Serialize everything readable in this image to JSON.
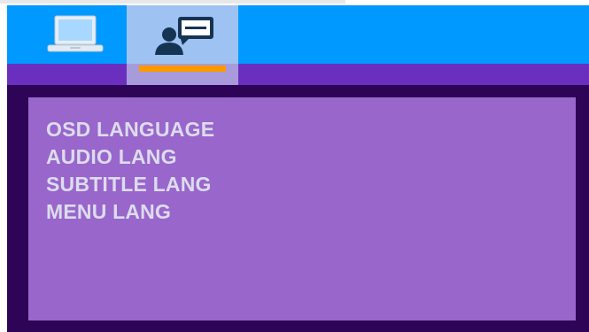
{
  "tabs": [
    {
      "icon": "monitor-icon",
      "selected": false
    },
    {
      "icon": "user-chat-icon",
      "selected": true
    }
  ],
  "colors": {
    "tab_bar": "#0099ff",
    "selected_tab": "#9ec2f2",
    "selected_underline": "#ff9900",
    "band": "#6b2fbf",
    "frame": "#2e0456",
    "panel": "#9966cc",
    "menu_text": "#dcdcec"
  },
  "menu": {
    "items": [
      {
        "label": "OSD LANGUAGE"
      },
      {
        "label": "AUDIO LANG"
      },
      {
        "label": "SUBTITLE LANG"
      },
      {
        "label": "MENU LANG"
      }
    ]
  }
}
